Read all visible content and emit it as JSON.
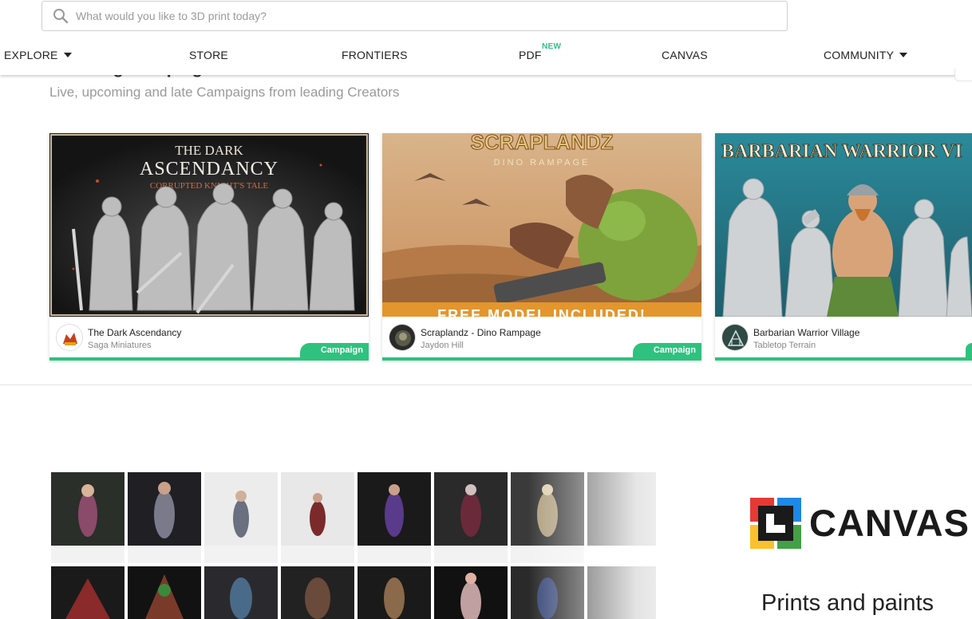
{
  "search": {
    "placeholder": "What would you like to 3D print today?"
  },
  "nav": {
    "explore": "EXPLORE",
    "store": "STORE",
    "frontiers": "FRONTIERS",
    "pdf": "PDF",
    "pdf_badge": "NEW",
    "canvas": "CANVAS",
    "community": "COMMUNITY"
  },
  "section": {
    "title": "Trending Campaigns",
    "subtitle": "Live, upcoming and late Campaigns from leading Creators"
  },
  "cards": [
    {
      "title": "The Dark Ascendancy",
      "creator": "Saga Miniatures",
      "badge": "Campaign",
      "banner_line1": "THE DARK",
      "banner_line2": "ASCENDANCY",
      "banner_line3": "CORRUPTED KNIGHT'S TALE"
    },
    {
      "title": "Scraplandz - Dino Rampage",
      "creator": "Jaydon Hill",
      "badge": "Campaign",
      "banner_line1": "SCRAPLANDZ",
      "banner_line2": "DINO RAMPAGE",
      "banner_line3": "FREE MODEL INCLUDED!"
    },
    {
      "title": "Barbarian Warrior Village",
      "creator": "Tabletop Terrain",
      "badge": "Campaign",
      "banner_line1": "BARBARIAN WARRIOR VI"
    }
  ],
  "canvas_banner": {
    "brand": "CANVAS",
    "tagline": "Prints and paints"
  },
  "colors": {
    "accent_green": "#2ec27e",
    "new_badge": "#2fbf8a"
  },
  "icons": {
    "search": "search-icon",
    "caret": "chevron-down-icon"
  }
}
